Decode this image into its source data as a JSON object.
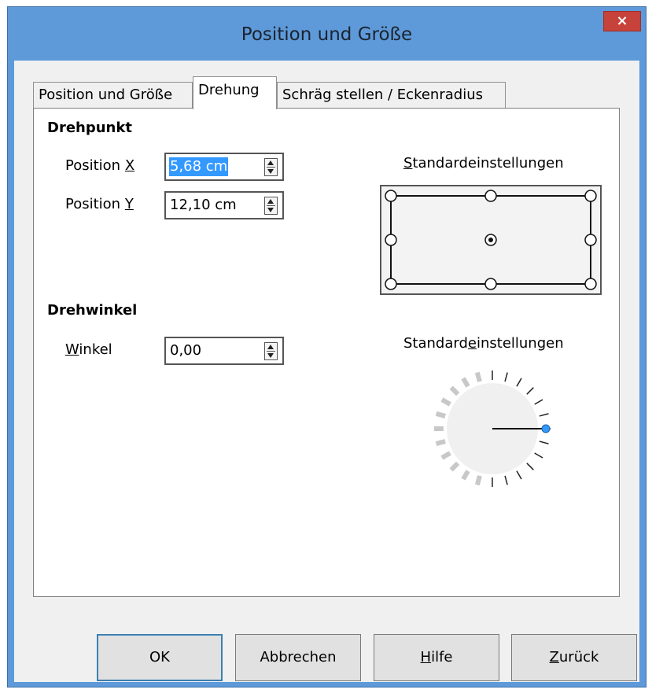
{
  "window": {
    "title": "Position und Größe",
    "close_label": "×"
  },
  "tabs": [
    {
      "label": "Position und Größe"
    },
    {
      "label": "Drehung"
    },
    {
      "label": "Schräg stellen / Eckenradius"
    }
  ],
  "pivot": {
    "heading": "Drehpunkt",
    "pos_x": {
      "label_pre": "Position ",
      "label_key": "X",
      "value": "5,68 cm"
    },
    "pos_y": {
      "label_pre": "Position ",
      "label_key": "Y",
      "value": "12,10 cm"
    },
    "defaults_label": {
      "key": "S",
      "rest": "tandardeinstellungen"
    }
  },
  "angle": {
    "heading": "Drehwinkel",
    "winkel": {
      "label_key": "W",
      "label_rest": "inkel",
      "value": "0,00"
    },
    "defaults_label": {
      "pre": "Standard",
      "key": "e",
      "post": "instellungen"
    },
    "dial_value_degrees": 0
  },
  "buttons": {
    "ok": "OK",
    "cancel": "Abbrechen",
    "help": {
      "key": "H",
      "rest": "ilfe"
    },
    "reset": {
      "key": "Z",
      "rest": "urück"
    }
  },
  "colors": {
    "titlebar": "#5e9ad9",
    "close": "#c7423a",
    "selection": "#3399ff",
    "dial_knob": "#3399ff"
  }
}
